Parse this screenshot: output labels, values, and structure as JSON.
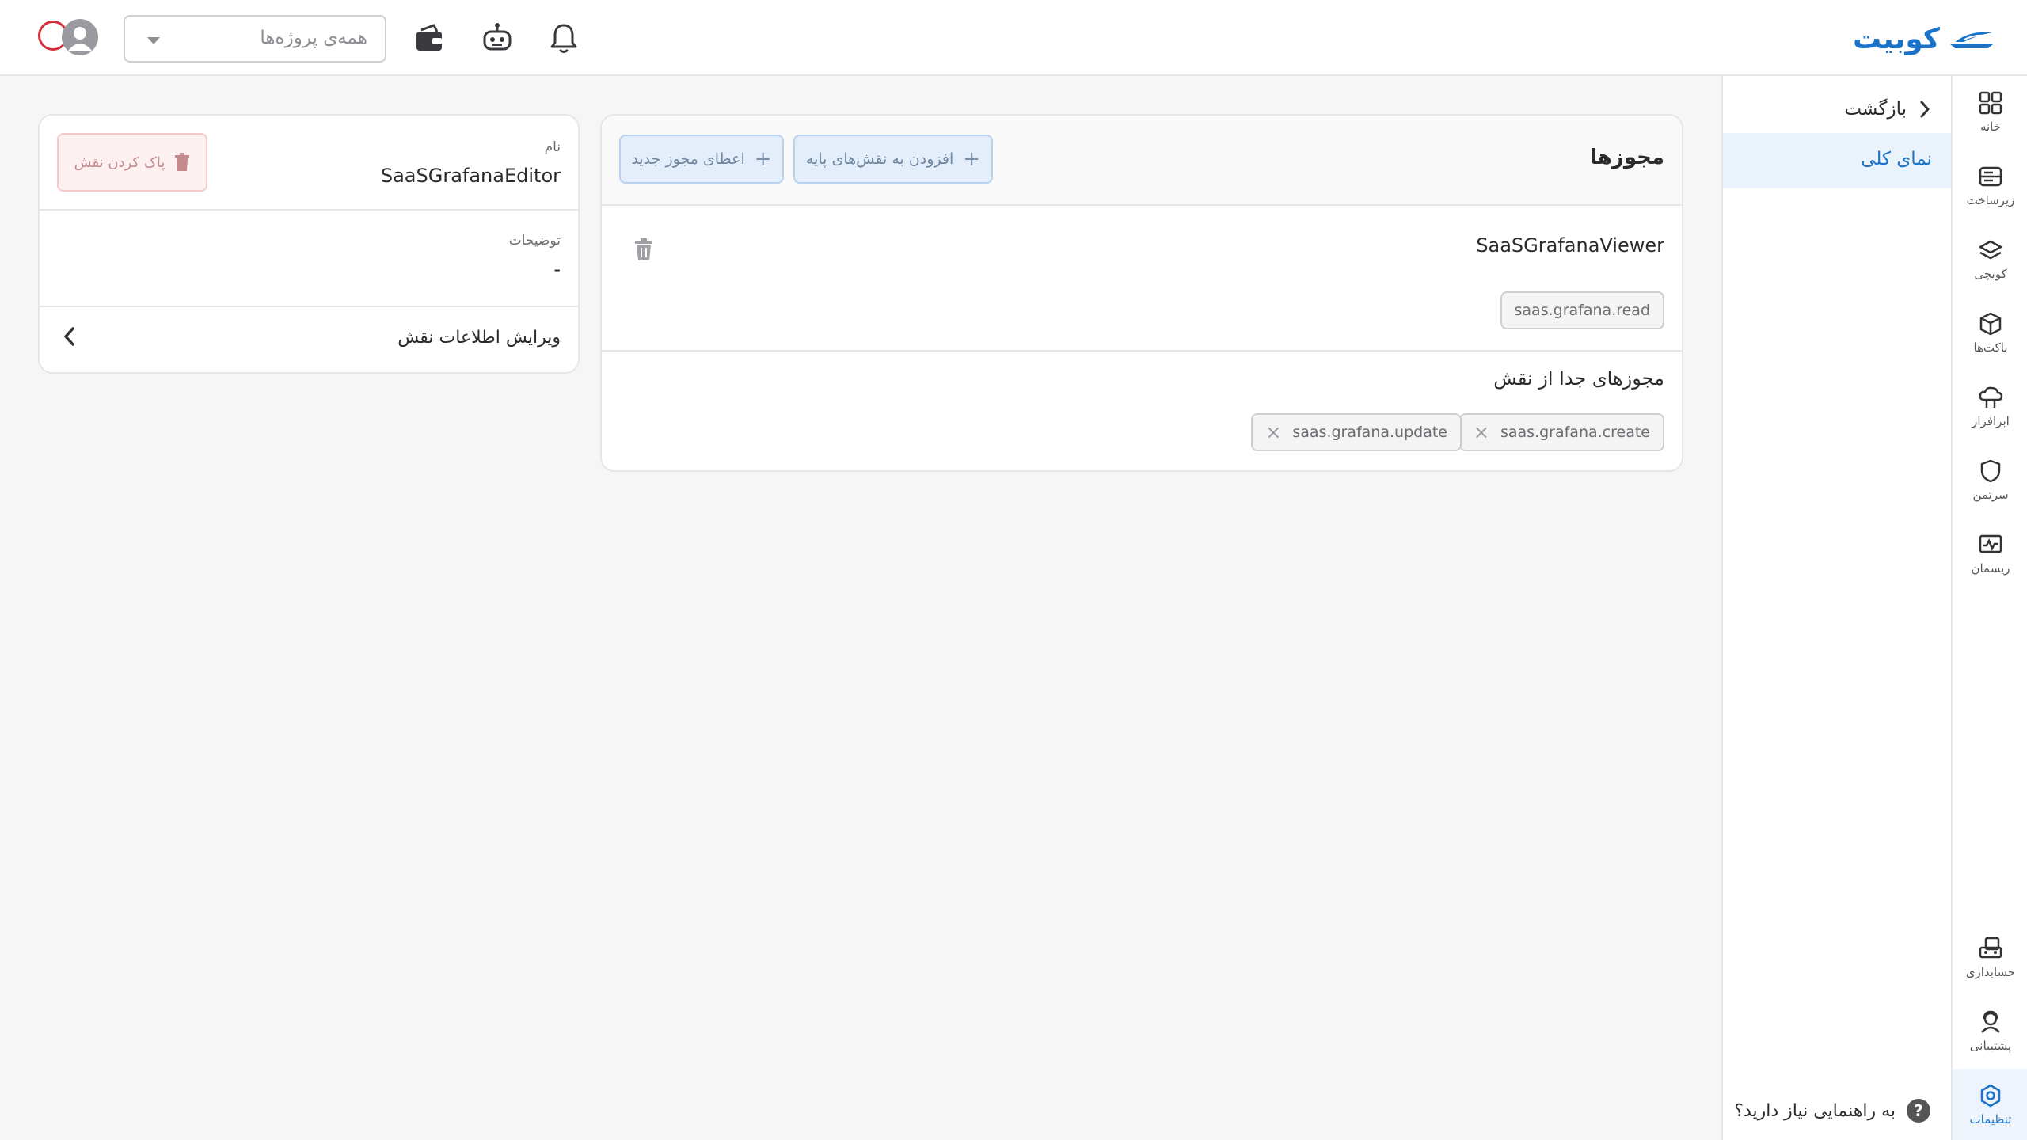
{
  "topbar": {
    "logo_text": "کوبیت",
    "project_select_placeholder": "همه‌ی پروژه‌ها",
    "icons": [
      "bell-icon",
      "robot-icon",
      "wallet-icon",
      "avatar-icon"
    ]
  },
  "rail": {
    "items": [
      {
        "label": "خانه",
        "icon": "grid-icon"
      },
      {
        "label": "زیرساخت",
        "icon": "server-icon"
      },
      {
        "label": "کوبچی",
        "icon": "layers-icon"
      },
      {
        "label": "باکت‌ها",
        "icon": "box-icon"
      },
      {
        "label": "ابرافزار",
        "icon": "cloud-app-icon"
      },
      {
        "label": "سرتمن",
        "icon": "shield-icon"
      },
      {
        "label": "ریسمان",
        "icon": "monitor-icon"
      }
    ],
    "bottom_items": [
      {
        "label": "حسابداری",
        "icon": "billing-icon"
      },
      {
        "label": "پشتیبانی",
        "icon": "support-icon"
      },
      {
        "label": "تنظیمات",
        "icon": "settings-icon",
        "active": true
      }
    ]
  },
  "subnav": {
    "back_label": "بازگشت",
    "overview_label": "نمای کلی",
    "help_label": "به راهنمایی نیاز دارید؟"
  },
  "permissions": {
    "title": "مجوزها",
    "add_to_base_roles": "افزودن به نقش‌های پایه",
    "grant_new_permission": "اعطای مجوز جدید",
    "base_role_name": "SaaSGrafanaViewer",
    "base_role_permissions": [
      "saas.grafana.read"
    ],
    "detached_title": "مجوزهای جدا از نقش",
    "detached_permissions": [
      "saas.grafana.create",
      "saas.grafana.update"
    ]
  },
  "role_info": {
    "name_label": "نام",
    "name_value": "SaaSGrafanaEditor",
    "delete_role_label": "پاک کردن نقش",
    "description_label": "توضیحات",
    "description_value": "-",
    "edit_label": "ویرایش اطلاعات نقش"
  },
  "colors": {
    "accent": "#1a73c9",
    "danger": "#d0303a",
    "border": "#e6e6e8"
  }
}
